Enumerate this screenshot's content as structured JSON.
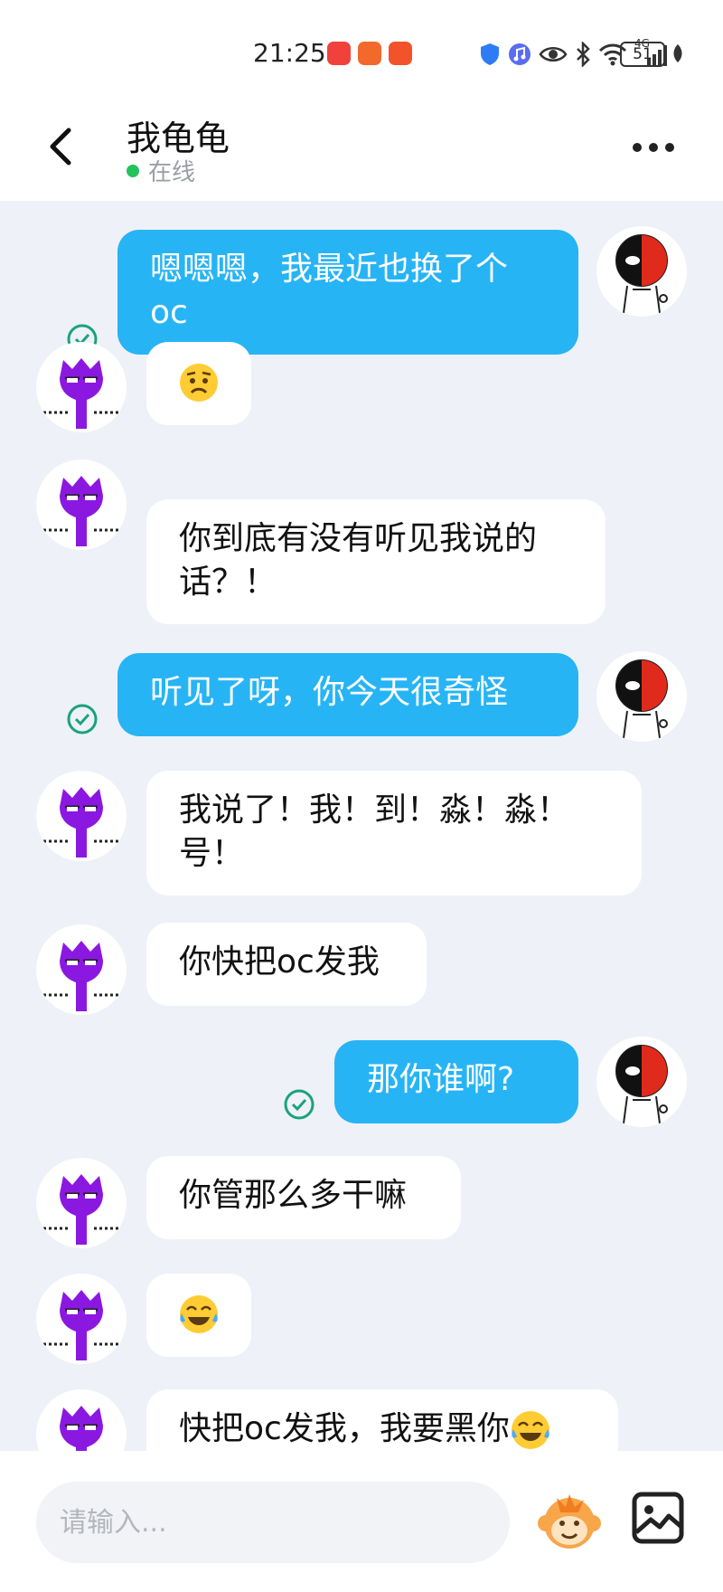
{
  "status_bar": {
    "time": "21:25",
    "network": "4G",
    "battery": "51"
  },
  "header": {
    "title": "我龟龟",
    "status": "在线"
  },
  "messages": [
    {
      "side": "out",
      "text_line1": "嗯嗯嗯，我最近也换了个",
      "text_line2": "oc",
      "read": true
    },
    {
      "side": "in",
      "emoji": "worried-face"
    },
    {
      "side": "in",
      "text_line1": "你到底有没有听见我说的",
      "text_line2": "话？！"
    },
    {
      "side": "out",
      "text": "听见了呀，你今天很奇怪",
      "read": true
    },
    {
      "side": "in",
      "text_line1": "我说了！我！到！淼！淼！",
      "text_line2": "号！"
    },
    {
      "side": "in",
      "text": "你快把oc发我"
    },
    {
      "side": "out",
      "text": "那你谁啊?",
      "read": true
    },
    {
      "side": "in",
      "text": "你管那么多干嘛"
    },
    {
      "side": "in",
      "emoji": "tears-of-joy-face"
    },
    {
      "side": "in",
      "text": "快把oc发我，我要黑你",
      "trailing_emoji": "tears-of-joy-face"
    }
  ],
  "input": {
    "placeholder": "请输入..."
  },
  "colors": {
    "accent": "#27b4f5",
    "online": "#23c35b",
    "read_check": "#1aa37a",
    "background": "#eff1f8"
  }
}
